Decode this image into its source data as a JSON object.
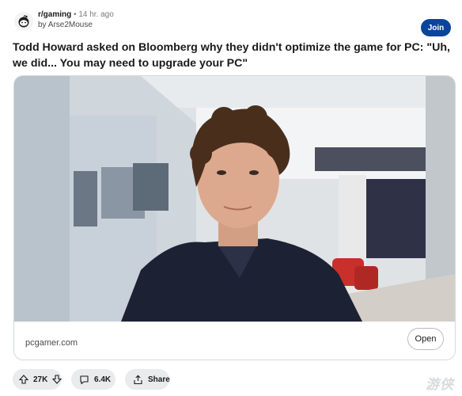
{
  "post": {
    "subreddit": "r/gaming",
    "separator": "•",
    "time": "14 hr. ago",
    "author": "by Arse2Mouse",
    "join_label": "Join",
    "title": "Todd Howard asked on Bloomberg why they didn't optimize the game for PC: \"Uh, we did... You may need to upgrade your PC\""
  },
  "link_card": {
    "domain": "pcgamer.com",
    "open_label": "Open",
    "image_subject": "man-with-curly-hair-in-office"
  },
  "actions": {
    "votes": "27K",
    "comments": "6.4K",
    "share_label": "Share"
  },
  "watermark": "游侠",
  "colors": {
    "join_bg": "#0a449b",
    "pill_bg": "#e9ebec",
    "card_border": "#d6dadc"
  },
  "icons": [
    "reddit-snoo-icon",
    "upvote-icon",
    "downvote-icon",
    "comment-icon",
    "share-icon"
  ]
}
